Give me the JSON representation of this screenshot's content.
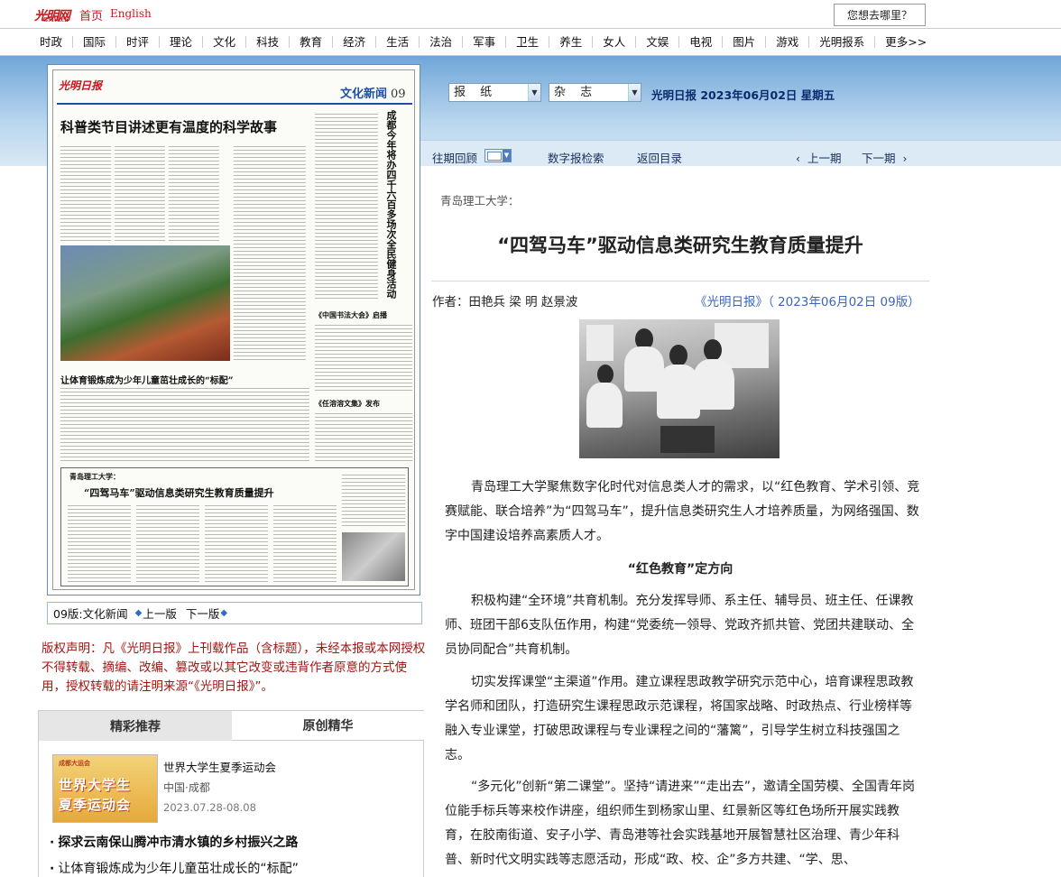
{
  "top": {
    "logo": "光明网",
    "logo_small": "GMW.cn",
    "home": "首页",
    "english": "English",
    "where": "您想去哪里？"
  },
  "nav": [
    "时政",
    "国际",
    "时评",
    "理论",
    "文化",
    "科技",
    "教育",
    "经济",
    "生活",
    "法治",
    "军事",
    "卫生",
    "养生",
    "女人",
    "文娱",
    "电视",
    "图片",
    "游戏",
    "光明报系",
    "更多>>"
  ],
  "selector": {
    "paper": "报 纸",
    "magazine": "杂 志",
    "date_line": "光明日报 2023年06月02日 星期五"
  },
  "tools": {
    "back_issues": "往期回顾",
    "digital_search": "数字报检索",
    "back_toc": "返回目录",
    "prev_issue": "上一期",
    "next_issue": "下一期"
  },
  "newspaper": {
    "masthead": "光明日报",
    "section": "文化新闻",
    "page_no": "09",
    "headline1": "科普类节目讲述更有温度的科学故事",
    "headline2": "让体育锻炼成为少年儿童茁壮成长的“标配”",
    "headline3": "青岛理工大学：",
    "headline4": "“四驾马车”驱动信息类研究生教育质量提升",
    "vertical": "成都今年将办四千六百多场次全民健身活动",
    "side1": "《中国书法大会》启播",
    "side2": "《任溶溶文集》发布"
  },
  "pagebar": {
    "page": "09版:文化新闻",
    "prev": "上一版",
    "next": "下一版"
  },
  "copyright": "版权声明：凡《光明日报》上刊载作品（含标题），未经本报或本网授权不得转载、摘编、改编、篡改或以其它改变或违背作者原意的方式使用，授权转载的请注明来源“《光明日报》”。",
  "recommend": {
    "tab1": "精彩推荐",
    "tab2": "原创精华",
    "feature_title": "世界大学生夏季运动会",
    "feature_loc": "中国·成都",
    "feature_date": "2023.07.28-08.08",
    "feature_img_line1": "世界大学生",
    "feature_img_line2": "夏季运动会",
    "feature_img_top": "成都大运会",
    "items": [
      "探求云南保山腾冲市清水镇的乡村振兴之路",
      "让体育锻炼成为少年儿童茁壮成长的“标配”"
    ]
  },
  "article": {
    "subtitle": "青岛理工大学：",
    "title": "“四驾马车”驱动信息类研究生教育质量提升",
    "author": "作者：田艳兵 梁 明 赵景波",
    "source": "《光明日报》（ 2023年06月02日  09版）",
    "p1": "青岛理工大学聚焦数字化时代对信息类人才的需求，以“红色教育、学术引领、竞赛赋能、联合培养”为“四驾马车”，提升信息类研究生人才培养质量，为网络强国、数字中国建设培养高素质人才。",
    "h1": "“红色教育”定方向",
    "p2": "积极构建“全环境”共育机制。充分发挥导师、系主任、辅导员、班主任、任课教师、班团干部6支队伍作用，构建“党委统一领导、党政齐抓共管、党团共建联动、全员协同配合”共育机制。",
    "p3": "切实发挥课堂“主渠道”作用。建立课程思政教学研究示范中心，培育课程思政教学名师和团队，打造研究生课程思政示范课程，将国家战略、时政热点、行业榜样等融入专业课堂，打破思政课程与专业课程之间的“藩篱”，引导学生树立科技强国之志。",
    "p4": "“多元化”创新“第二课堂”。坚持“请进来”“走出去”，邀请全国劳模、全国青年岗位能手标兵等来校作讲座，组织师生到杨家山里、红景新区等红色场所开展实践教育，在胶南街道、安子小学、青岛港等社会实践基地开展智慧社区治理、青少年科普、新时代文明实践等志愿活动，形成“政、校、企”多方共建、“学、思、"
  }
}
